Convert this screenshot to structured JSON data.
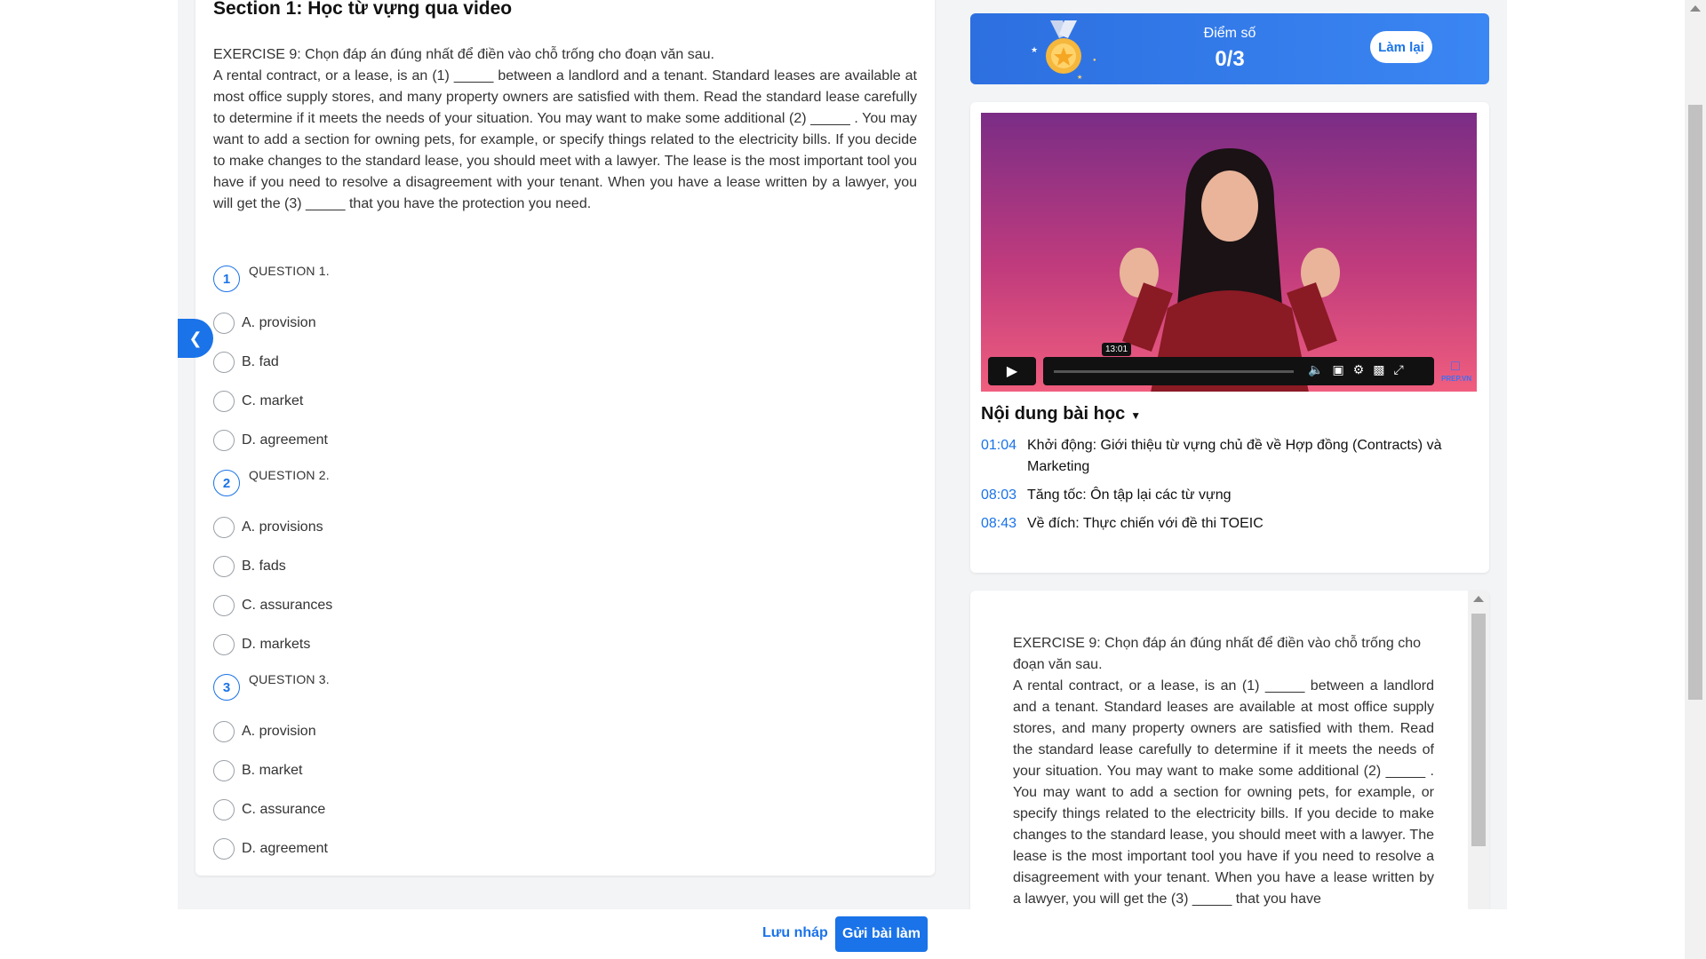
{
  "section": {
    "title": "Section 1: Học từ vựng qua video"
  },
  "exercise": {
    "heading": "EXERCISE 9: Chọn đáp án đúng nhất để điền vào chỗ trống cho đoạn văn sau.",
    "passage": "A rental contract, or a lease, is an (1) _____ between a landlord and a tenant. Standard leases are available at most office supply stores, and many property owners are satisfied with them. Read the standard lease carefully to determine if it meets the needs of your situation. You may want to make some additional (2) _____ . You may want to add a section for owning pets, for example, or specify things related to the electricity bills. If you decide to make changes to the standard lease, you should meet with a lawyer. The lease is the most important tool you have if you need to resolve a disagreement with your tenant. When you have a lease written by a lawyer, you will get the (3) _____ that you have the protection you need."
  },
  "questions": [
    {
      "number": "1",
      "label": "QUESTION 1.",
      "options": [
        "A. provision",
        "B. fad",
        "C. market",
        "D. agreement"
      ]
    },
    {
      "number": "2",
      "label": "QUESTION 2.",
      "options": [
        "A. provisions",
        "B. fads",
        "C. assurances",
        "D. markets"
      ]
    },
    {
      "number": "3",
      "label": "QUESTION 3.",
      "options": [
        "A. provision",
        "B. market",
        "C. assurance",
        "D. agreement"
      ]
    }
  ],
  "score": {
    "label": "Điểm số",
    "value": "0/3",
    "retry_label": "Làm lại"
  },
  "video": {
    "timestamp_tooltip": "13:01",
    "brand": "PREP.VN"
  },
  "contents": {
    "title": "Nội dung bài học",
    "chapters": [
      {
        "time": "01:04",
        "title": "Khởi động: Giới thiệu từ vựng chủ đề về Hợp đồng (Contracts) và Marketing"
      },
      {
        "time": "08:03",
        "title": "Tăng tốc: Ôn tập lại các từ vựng"
      },
      {
        "time": "08:43",
        "title": "Về đích: Thực chiến với đề thi TOEIC"
      }
    ]
  },
  "reading": {
    "heading": "EXERCISE 9: Chọn đáp án đúng nhất để điền vào chỗ trống cho đoạn văn sau.",
    "passage": "A rental contract, or a lease, is an (1) _____ between a landlord and a tenant. Standard leases are available at most office supply stores, and many property owners are satisfied with them. Read the standard lease carefully to determine if it meets the needs of your situation. You may want to make some additional (2) _____ . You may want to add a section for owning pets, for example, or specify things related to the electricity bills. If you decide to make changes to the standard lease, you should meet with a lawyer. The lease is the most important tool you have if you need to resolve a disagreement with your tenant. When you have a lease written by a lawyer, you will get the (3) _____ that you have"
  },
  "footer": {
    "save_draft_label": "Lưu nháp",
    "submit_label": "Gửi bài làm"
  },
  "colors": {
    "accent": "#1a73e8",
    "banner": "#2d6fe0"
  }
}
